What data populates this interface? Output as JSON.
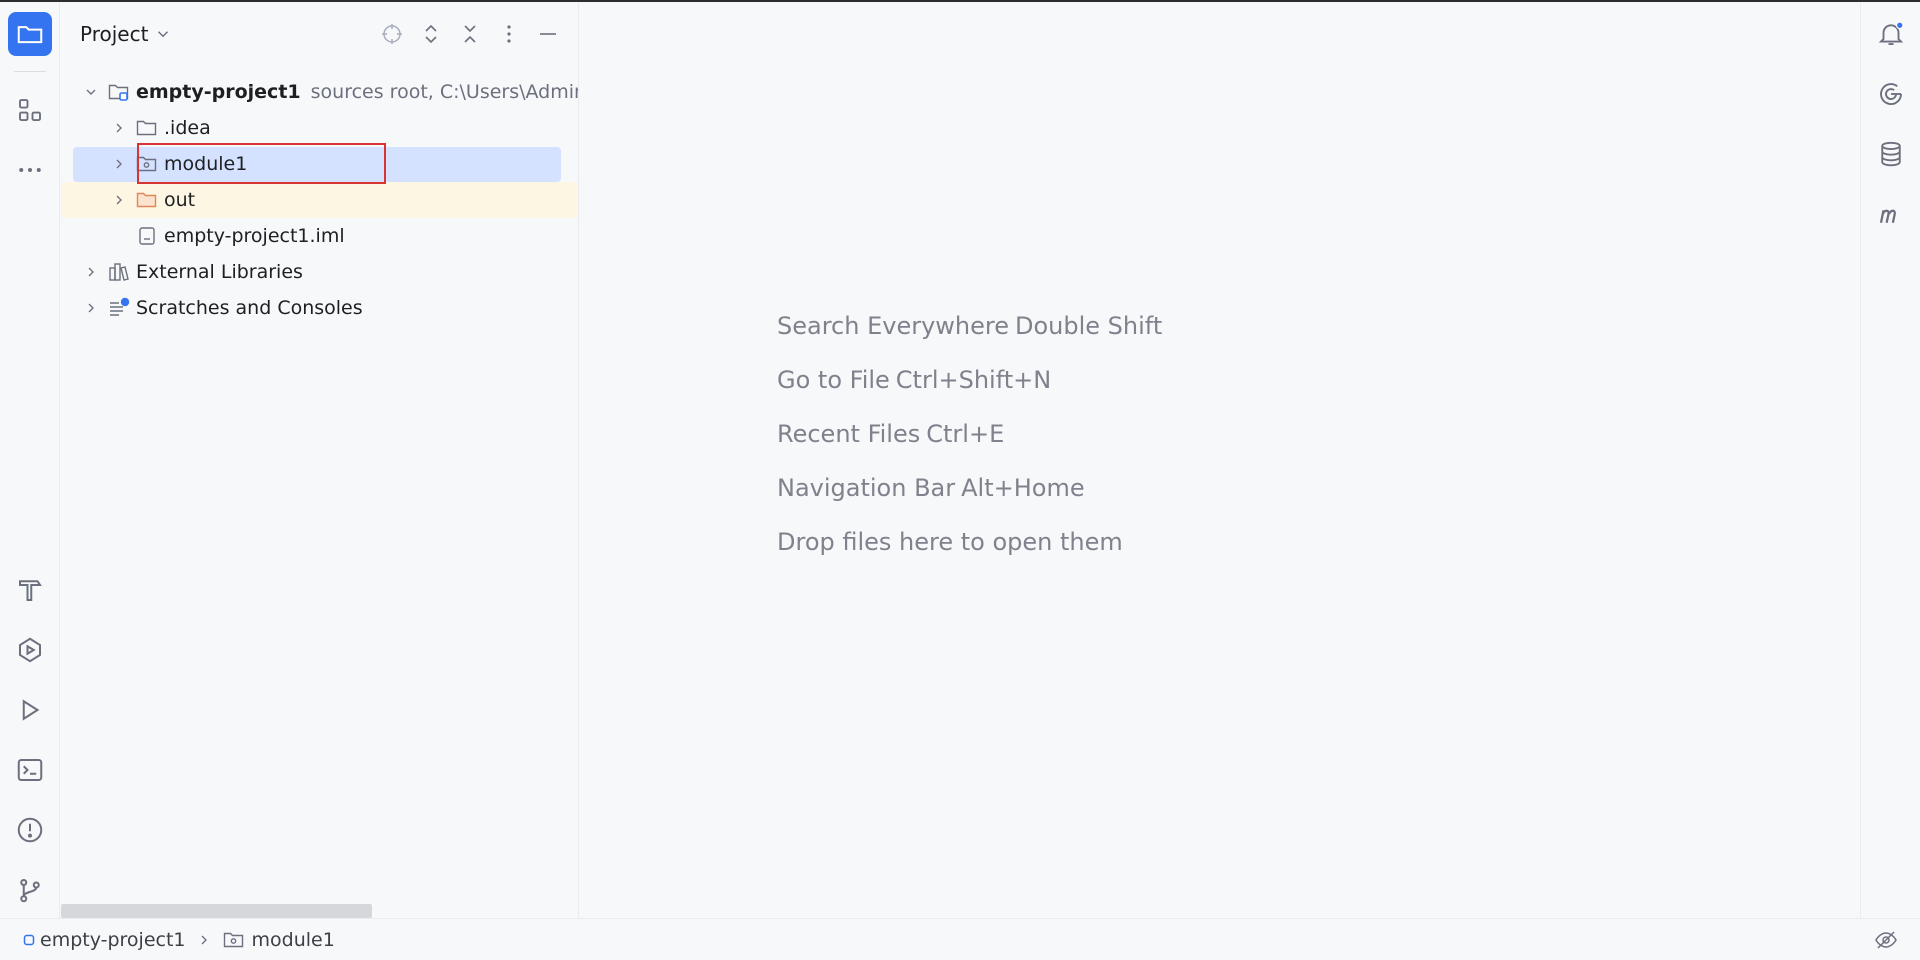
{
  "panel": {
    "title": "Project"
  },
  "tree": {
    "root": {
      "name": "empty-project1",
      "hint": "sources root,  C:\\Users\\Admini"
    },
    "items": [
      {
        "label": ".idea"
      },
      {
        "label": "module1"
      },
      {
        "label": "out"
      },
      {
        "label": "empty-project1.iml"
      }
    ],
    "top_level": [
      {
        "label": "External Libraries"
      },
      {
        "label": "Scratches and Consoles"
      }
    ]
  },
  "editor": {
    "hints": [
      {
        "text": "Search Everywhere",
        "shortcut": "Double Shift"
      },
      {
        "text": "Go to File",
        "shortcut": "Ctrl+Shift+N"
      },
      {
        "text": "Recent Files",
        "shortcut": "Ctrl+E"
      },
      {
        "text": "Navigation Bar",
        "shortcut": "Alt+Home"
      },
      {
        "text": "Drop files here to open them",
        "shortcut": ""
      }
    ]
  },
  "statusbar": {
    "crumbs": [
      "empty-project1",
      "module1"
    ]
  },
  "colors": {
    "accent": "#3574f0",
    "selection": "#d4e2ff",
    "excluded_bg": "#fdf6e3",
    "highlight_border": "#d93434",
    "folder_excluded": "#e08855",
    "notification_dot": "#3574f0"
  },
  "icons": {
    "left_strip": [
      "project-folder-icon",
      "structure-icon",
      "more-icon",
      "build-icon",
      "services-icon",
      "run-icon",
      "terminal-icon",
      "problems-icon",
      "git-icon"
    ],
    "right_strip": [
      "notifications-icon",
      "ai-assistant-icon",
      "database-icon",
      "maven-icon"
    ]
  }
}
